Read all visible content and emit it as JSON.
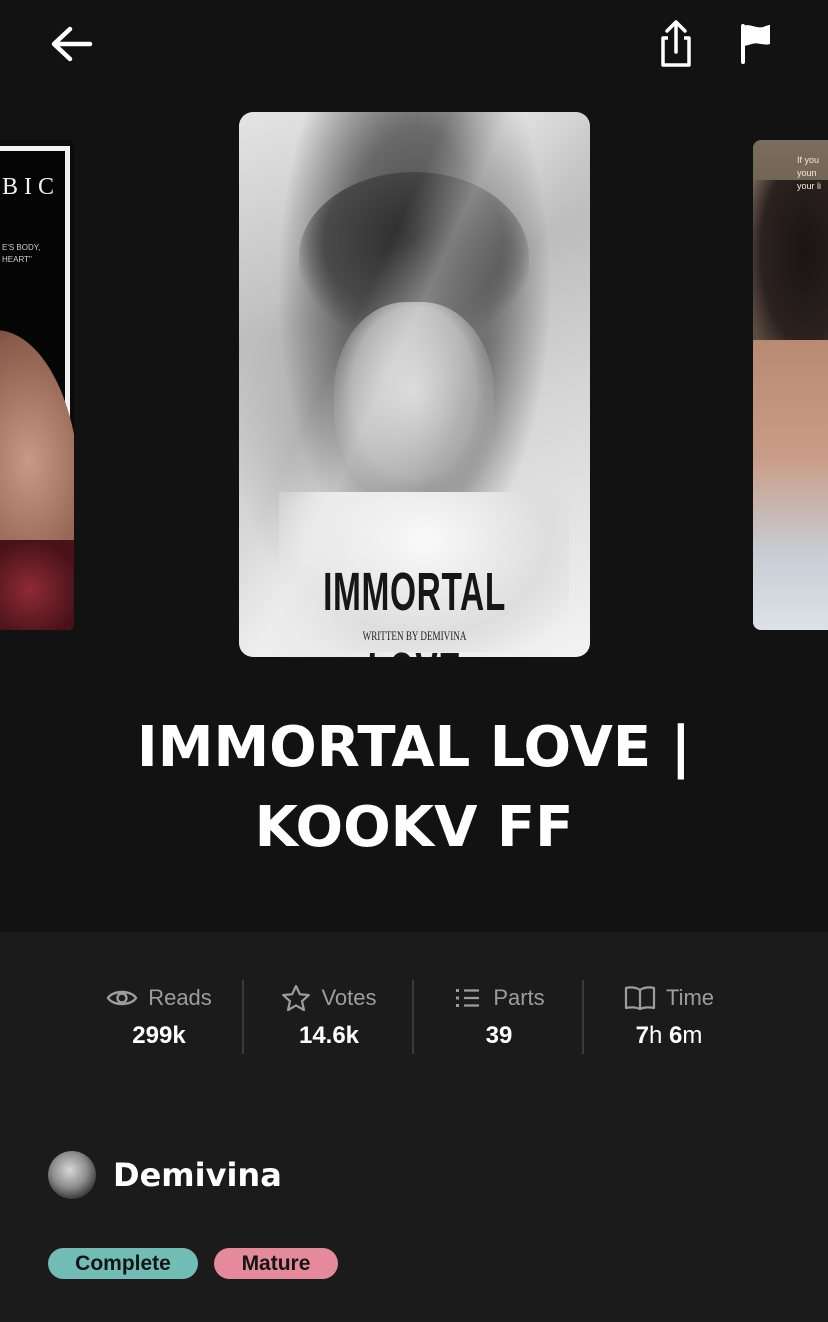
{
  "topbar": {
    "back_icon": "arrow-left-icon",
    "share_icon": "share-icon",
    "report_icon": "flag-icon"
  },
  "carousel": {
    "left_cover": {
      "title_fragment": "BIC",
      "tagline_fragment": "E'S BODY,\nHEART\""
    },
    "main_cover": {
      "title": "IMMORTAL LOVE",
      "byline": "WRITTEN BY DEMIVINA"
    },
    "right_cover": {
      "text_fragment": "If you\nyoun\nyour li"
    }
  },
  "book": {
    "title": "IMMORTAL LOVE | KOOKV FF"
  },
  "stats": [
    {
      "label": "Reads",
      "value": "299k",
      "icon": "eye-icon"
    },
    {
      "label": "Votes",
      "value": "14.6k",
      "icon": "star-icon"
    },
    {
      "label": "Parts",
      "value": "39",
      "icon": "list-icon"
    },
    {
      "label": "Time",
      "value_hours": "7",
      "hours_unit": "h",
      "value_minutes": "6",
      "minutes_unit": "m",
      "icon": "book-open-icon"
    }
  ],
  "author": {
    "name": "Demivina"
  },
  "tags": [
    {
      "label": "Complete",
      "color": "#72bcb6"
    },
    {
      "label": "Mature",
      "color": "#e58a9b"
    }
  ],
  "colors": {
    "background": "#1b1b1b",
    "hero_background": "#121212",
    "muted_text": "#9d9d9d"
  }
}
